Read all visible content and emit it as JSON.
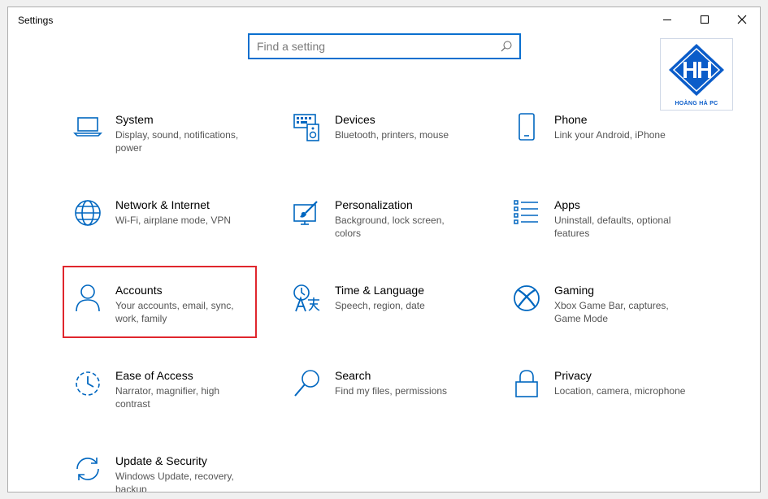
{
  "window": {
    "title": "Settings"
  },
  "search": {
    "placeholder": "Find a setting"
  },
  "logo": {
    "text": "HOÀNG HÀ PC"
  },
  "colors": {
    "accent": "#0067c0",
    "highlight": "#e0262d",
    "search_border": "#0a6fcf"
  },
  "tiles": [
    {
      "name": "System",
      "desc": "Display, sound, notifications, power",
      "icon": "laptop-icon"
    },
    {
      "name": "Devices",
      "desc": "Bluetooth, printers, mouse",
      "icon": "keyboard-speaker-icon"
    },
    {
      "name": "Phone",
      "desc": "Link your Android, iPhone",
      "icon": "phone-icon"
    },
    {
      "name": "Network & Internet",
      "desc": "Wi-Fi, airplane mode, VPN",
      "icon": "globe-icon"
    },
    {
      "name": "Personalization",
      "desc": "Background, lock screen, colors",
      "icon": "paint-icon"
    },
    {
      "name": "Apps",
      "desc": "Uninstall, defaults, optional features",
      "icon": "apps-list-icon"
    },
    {
      "name": "Accounts",
      "desc": "Your accounts, email, sync, work, family",
      "icon": "person-icon"
    },
    {
      "name": "Time & Language",
      "desc": "Speech, region, date",
      "icon": "time-language-icon"
    },
    {
      "name": "Gaming",
      "desc": "Xbox Game Bar, captures, Game Mode",
      "icon": "xbox-icon"
    },
    {
      "name": "Ease of Access",
      "desc": "Narrator, magnifier, high contrast",
      "icon": "ease-of-access-icon"
    },
    {
      "name": "Search",
      "desc": "Find my files, permissions",
      "icon": "search-icon"
    },
    {
      "name": "Privacy",
      "desc": "Location, camera, microphone",
      "icon": "lock-icon"
    },
    {
      "name": "Update & Security",
      "desc": "Windows Update, recovery, backup",
      "icon": "update-icon"
    }
  ]
}
